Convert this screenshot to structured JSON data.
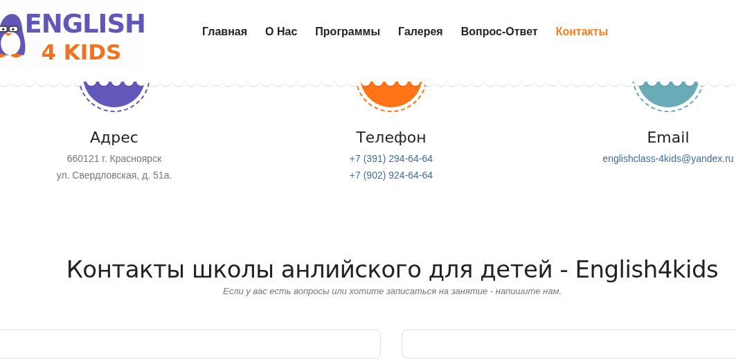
{
  "logo": {
    "line_1": "ENGLISH",
    "line_2": "4 KIDS"
  },
  "nav": [
    {
      "label": "Главная",
      "selected": false
    },
    {
      "label": "О Нас",
      "selected": false
    },
    {
      "label": "Программы",
      "selected": false
    },
    {
      "label": "Галерея",
      "selected": false
    },
    {
      "label": "Вопрос-Ответ",
      "selected": false
    },
    {
      "label": "Контакты",
      "selected": true
    }
  ],
  "contacts": [
    {
      "title": "Адрес",
      "color": "#6258b9",
      "kind": "text",
      "lines": [
        "660121 г. Красноярск",
        "ул. Свердловская, д. 51а."
      ]
    },
    {
      "title": "Телефон",
      "color": "#fe7416",
      "kind": "link",
      "lines": [
        "+7 (391) 294-64-64",
        "+7 (902) 924-64-64"
      ]
    },
    {
      "title": "Email",
      "color": "#6aabb8",
      "kind": "link",
      "lines": [
        "englishclass-4kids@yandex.ru"
      ]
    }
  ],
  "section": {
    "heading": "Контакты школы анлийского для детей - English4kids",
    "subtitle": "Если у вас есть вопросы или хотите записаться на занятие - напишите нам."
  }
}
